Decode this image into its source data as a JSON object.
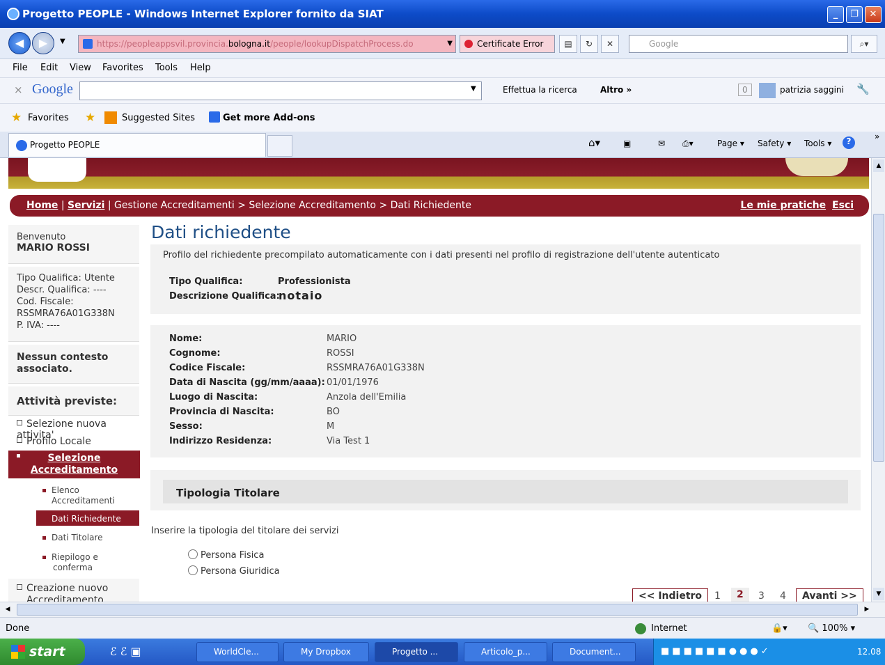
{
  "window": {
    "title": "Progetto PEOPLE - Windows Internet Explorer fornito da SIAT"
  },
  "address_bar": {
    "url_before": "https://peopleappsvil.provincia.",
    "url_domain": "bologna.it",
    "url_after": "/people/lookupDispatchProcess.do",
    "cert_error": "Certificate Error",
    "search_placeholder": "Google"
  },
  "menu": {
    "items": [
      "File",
      "Edit",
      "View",
      "Favorites",
      "Tools",
      "Help"
    ]
  },
  "google_bar": {
    "logo": "Google",
    "search_label": "Effettua la ricerca",
    "more": "Altro »",
    "count": "0",
    "user": "patrizia saggini"
  },
  "favorites_bar": {
    "favorites": "Favorites",
    "suggested": "Suggested Sites",
    "addons": "Get more Add-ons"
  },
  "tab": {
    "title": "Progetto PEOPLE"
  },
  "commands": {
    "page": "Page",
    "safety": "Safety",
    "tools": "Tools"
  },
  "breadcrumb": {
    "home": "Home",
    "servizi": "Servizi",
    "path": "Gestione Accreditamenti > Selezione Accreditamento > Dati Richiedente",
    "mie_pratiche": "Le mie pratiche",
    "esci": "Esci"
  },
  "sidebar": {
    "welcome": "Benvenuto",
    "user": "MARIO ROSSI",
    "tipo_qualifica": "Tipo Qualifica: Utente",
    "descr_qualifica": "Descr. Qualifica: ----",
    "cod_fiscale_label": "Cod. Fiscale:",
    "cod_fiscale": "RSSMRA76A01G338N",
    "piva": "P. IVA: ----",
    "contesto": "Nessun contesto associato.",
    "attivita": "Attività previste:",
    "item_nuova": "Selezione nuova attivita'",
    "item_profilo": "Profilo Locale",
    "active_line1": "Selezione",
    "active_line2": "Accreditamento",
    "sub_elenco_1": "Elenco",
    "sub_elenco_2": "Accreditamenti",
    "sub_dati_richiedente": "Dati Richiedente",
    "sub_dati_titolare": "Dati Titolare",
    "sub_riepilogo_1": "Riepilogo e",
    "sub_riepilogo_2": "conferma",
    "item_creazione_1": "Creazione nuovo",
    "item_creazione_2": "Accreditamento"
  },
  "main": {
    "title": "Dati richiedente",
    "intro": "Profilo del richiedente precompilato automaticamente con i dati presenti nel profilo di registrazione dell'utente autenticato",
    "qualifica": {
      "tipo_label": "Tipo Qualifica:",
      "tipo_value": "Professionista",
      "descr_label": "Descrizione Qualifica:",
      "descr_value": "notaio"
    },
    "fields": [
      {
        "label": "Nome:",
        "value": "MARIO"
      },
      {
        "label": "Cognome:",
        "value": "ROSSI"
      },
      {
        "label": "Codice Fiscale:",
        "value": "RSSMRA76A01G338N"
      },
      {
        "label": "Data di Nascita (gg/mm/aaaa):",
        "value": "01/01/1976"
      },
      {
        "label": "Luogo di Nascita:",
        "value": "Anzola dell'Emilia"
      },
      {
        "label": "Provincia di Nascita:",
        "value": "BO"
      },
      {
        "label": "Sesso:",
        "value": "M"
      },
      {
        "label": "Indirizzo Residenza:",
        "value": "Via Test 1"
      }
    ],
    "tipologia_title": "Tipologia Titolare",
    "tipologia_hint": "Inserire la tipologia del titolare dei servizi",
    "option_fisica": "Persona Fisica",
    "option_giuridica": "Persona Giuridica"
  },
  "pager": {
    "prev": "<< Indietro",
    "pages": [
      "1",
      "2",
      "3",
      "4"
    ],
    "current": "2",
    "next": "Avanti >>"
  },
  "status": {
    "left": "Done",
    "zone": "Internet",
    "zoom": "100%"
  },
  "taskbar": {
    "start": "start",
    "items": [
      "WorldCle...",
      "My Dropbox",
      "Progetto ...",
      "Articolo_p...",
      "Document..."
    ],
    "clock": "12.08"
  }
}
